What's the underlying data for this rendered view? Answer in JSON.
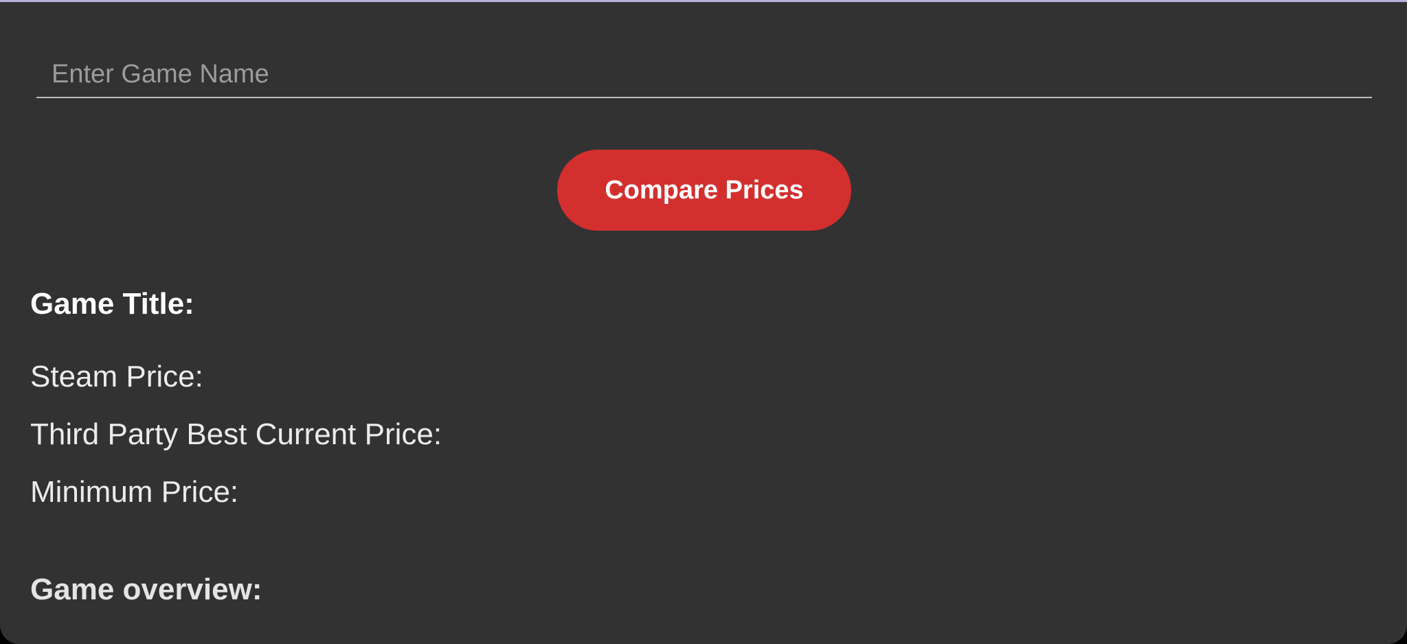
{
  "theme": {
    "accent": "#d32f2f",
    "background": "#323232",
    "top_border": "#b7b0da"
  },
  "search": {
    "placeholder": "Enter Game Name",
    "value": ""
  },
  "actions": {
    "compare_label": "Compare Prices"
  },
  "results": {
    "game_title_label": "Game Title:",
    "steam_price_label": "Steam Price:",
    "third_party_price_label": "Third Party Best Current Price:",
    "minimum_price_label": "Minimum Price:",
    "overview_label": "Game overview:"
  }
}
